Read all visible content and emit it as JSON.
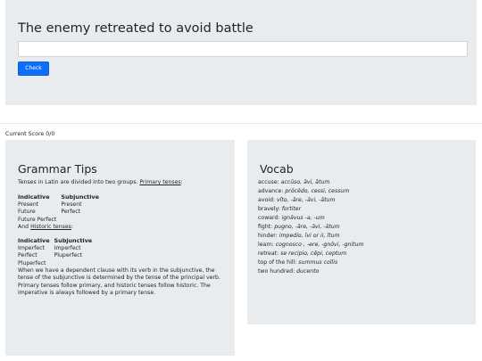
{
  "exercise": {
    "sentence": "The enemy retreated to avoid battle",
    "answer_value": "",
    "check_label": "Check"
  },
  "score_text": "Current Score 0/0",
  "grammar": {
    "title": "Grammar Tips",
    "intro_text": "Tenses in Latin are divided into two groups. ",
    "primary_link": "Primary tenses",
    "intro_end": ":",
    "primary_headers": [
      "Indicative",
      "Subjunctive"
    ],
    "primary_rows": [
      [
        "Present",
        "Present"
      ],
      [
        "Future",
        "Perfect"
      ],
      [
        "Future Perfect",
        ""
      ]
    ],
    "historic_intro": "And ",
    "historic_link": "Historic tenses",
    "historic_end": ":",
    "historic_headers": [
      "Indicative",
      "Subjunctive"
    ],
    "historic_rows": [
      [
        "Imperfect",
        "Imperfect"
      ],
      [
        "Perfect",
        "Pluperfect"
      ],
      [
        "Pluperfect",
        ""
      ]
    ],
    "explanation": "When we have a dependent clause with its verb in the subjunctive, the tense of the subjunctive is determined by the tense of the principal verb. Primary tenses follow primary, and historic tenses follow historic. The imperative is always followed by a primary tense."
  },
  "vocab": {
    "title": "Vocab",
    "items": [
      {
        "english": "accuse: ",
        "latin": "accūso, āvi, ātum"
      },
      {
        "english": "advance: ",
        "latin": "prōcēdo, cessi, cessum"
      },
      {
        "english": "avoid: ",
        "latin": "vīto, -āre, -āvi, -ātum"
      },
      {
        "english": "bravely: ",
        "latin": "fortiter"
      },
      {
        "english": "coward: ",
        "latin": "ignāvus -a, -um"
      },
      {
        "english": "fight: ",
        "latin": "pugno, -āre, -āvi, -ātum"
      },
      {
        "english": "hinder: ",
        "latin": "impedio, īvi or ii, ītum"
      },
      {
        "english": "learn: ",
        "latin": "cognosco , -ere, -gnōvi, -gnitum"
      },
      {
        "english": "retreat: ",
        "latin": "se recipio, cēpi, ceptum"
      },
      {
        "english": "top of the hill: ",
        "latin": "summus collis"
      },
      {
        "english": "two hundred: ",
        "latin": "ducento"
      }
    ]
  },
  "colors": {
    "panel_bg": "#e9ecef",
    "button_bg": "#0d6efd",
    "text": "#212529"
  }
}
